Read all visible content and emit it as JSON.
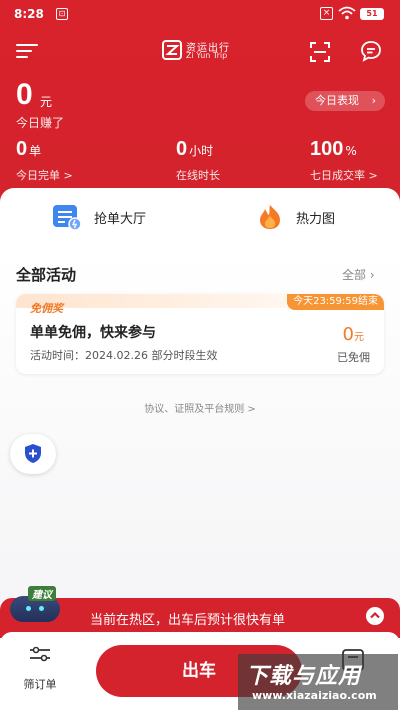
{
  "status_bar": {
    "time": "8:28",
    "sim_icon": "sim-card-icon",
    "battery": "51"
  },
  "header": {
    "logo_cn": "资运出行",
    "logo_en": "Zi Yun Trip",
    "earnings_amount": "0",
    "earnings_unit": "元",
    "earnings_label": "今日赚了",
    "today_performance": "今日表现",
    "stats": [
      {
        "value": "0",
        "unit": "单",
        "label": "今日完单 >"
      },
      {
        "value": "0",
        "unit": "小时",
        "label": "在线时长"
      },
      {
        "value": "100",
        "unit": "%",
        "label": "七日成交率 >"
      }
    ],
    "colors": {
      "brand_red": "#d8222c"
    }
  },
  "quick_actions": [
    {
      "label": "抢单大厅",
      "icon": "order-hall-icon"
    },
    {
      "label": "热力图",
      "icon": "heatmap-flame-icon"
    }
  ],
  "activities": {
    "title": "全部活动",
    "all_label": "全部",
    "items": [
      {
        "badge": "免佣奖",
        "deadline": "今天23:59:59结束",
        "title": "单单免佣，快来参与",
        "time": "活动时间：2024.02.26 部分时段生效",
        "amount": "0",
        "amount_unit": "元",
        "status": "已免佣"
      }
    ]
  },
  "rules_link": "协议、证照及平台规则 >",
  "suggest_tag": "建议",
  "hotzone_text": "当前在热区，出车后预计很快有单",
  "bottom": {
    "filter_label": "筛订单",
    "go_button": "出车"
  },
  "watermark": {
    "title": "下载与应用",
    "url": "www.xiazaiziao.com"
  }
}
